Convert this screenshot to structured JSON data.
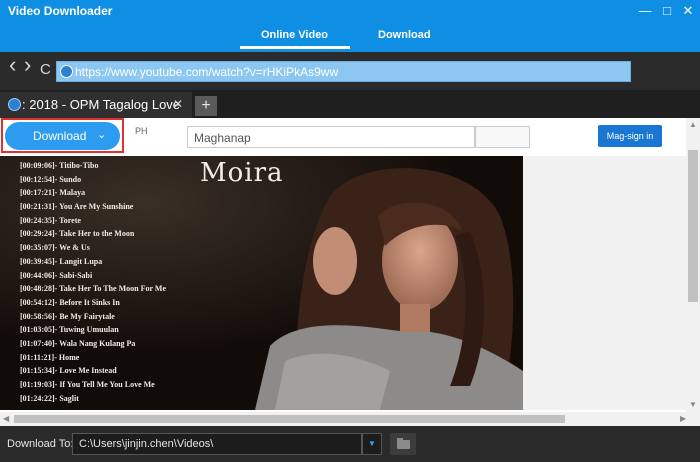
{
  "app": {
    "title": "Video Downloader"
  },
  "window_controls": {
    "minimize": "—",
    "maximize": "□",
    "close": "✕"
  },
  "main_tabs": [
    {
      "label": "Online Video",
      "active": true
    },
    {
      "label": "Download",
      "active": false
    }
  ],
  "navigation": {
    "back": "‹",
    "forward": "›",
    "reload": "C",
    "url": "https://www.youtube.com/watch?v=rHKiPkAs9ww"
  },
  "browser_tab": {
    "title": ": 2018 - OPM Tagalog Love",
    "close": "✕",
    "new_tab": "+"
  },
  "page": {
    "download_button": {
      "label": "Download",
      "chevron": "⌄"
    },
    "region_code": "PH",
    "search": {
      "placeholder": "Maghanap"
    },
    "sign_in_label": "Mag-sign in"
  },
  "video": {
    "artist": "Moira",
    "tracks": [
      "[00:09:06]- Titibo-Tibo",
      "[00:12:54]- Sundo",
      "[00:17:21]- Malaya",
      "[00:21:31]- You Are My Sunshine",
      "[00:24:35]- Torete",
      "[00:29:24]- Take Her to the Moon",
      "[00:35:07]- We & Us",
      "[00:39:45]- Langit Lupa",
      "[00:44:06]- Sabi-Sabi",
      "[00:48:28]- Take Her To The Moon For Me",
      "[00:54:12]- Before It Sinks In",
      "[00:58:56]- Be My Fairytale",
      "[01:03:05]- Tuwing Umuulan",
      "[01:07:40]- Wala Nang Kulang Pa",
      "[01:11:21]- Home",
      "[01:15:34]- Love Me Instead",
      "[01:19:03]- If You Tell Me You Love Me",
      "[01:24:22]- Saglit"
    ]
  },
  "bottom_bar": {
    "label": "Download To:",
    "path": "C:\\Users\\jinjin.chen\\Videos\\",
    "dropdown_icon": "▼"
  },
  "colors": {
    "title_bar": "#0f8fe4",
    "download_button": "#2d9cf0",
    "highlight": "#e03030",
    "sign_in": "#1976d2"
  }
}
